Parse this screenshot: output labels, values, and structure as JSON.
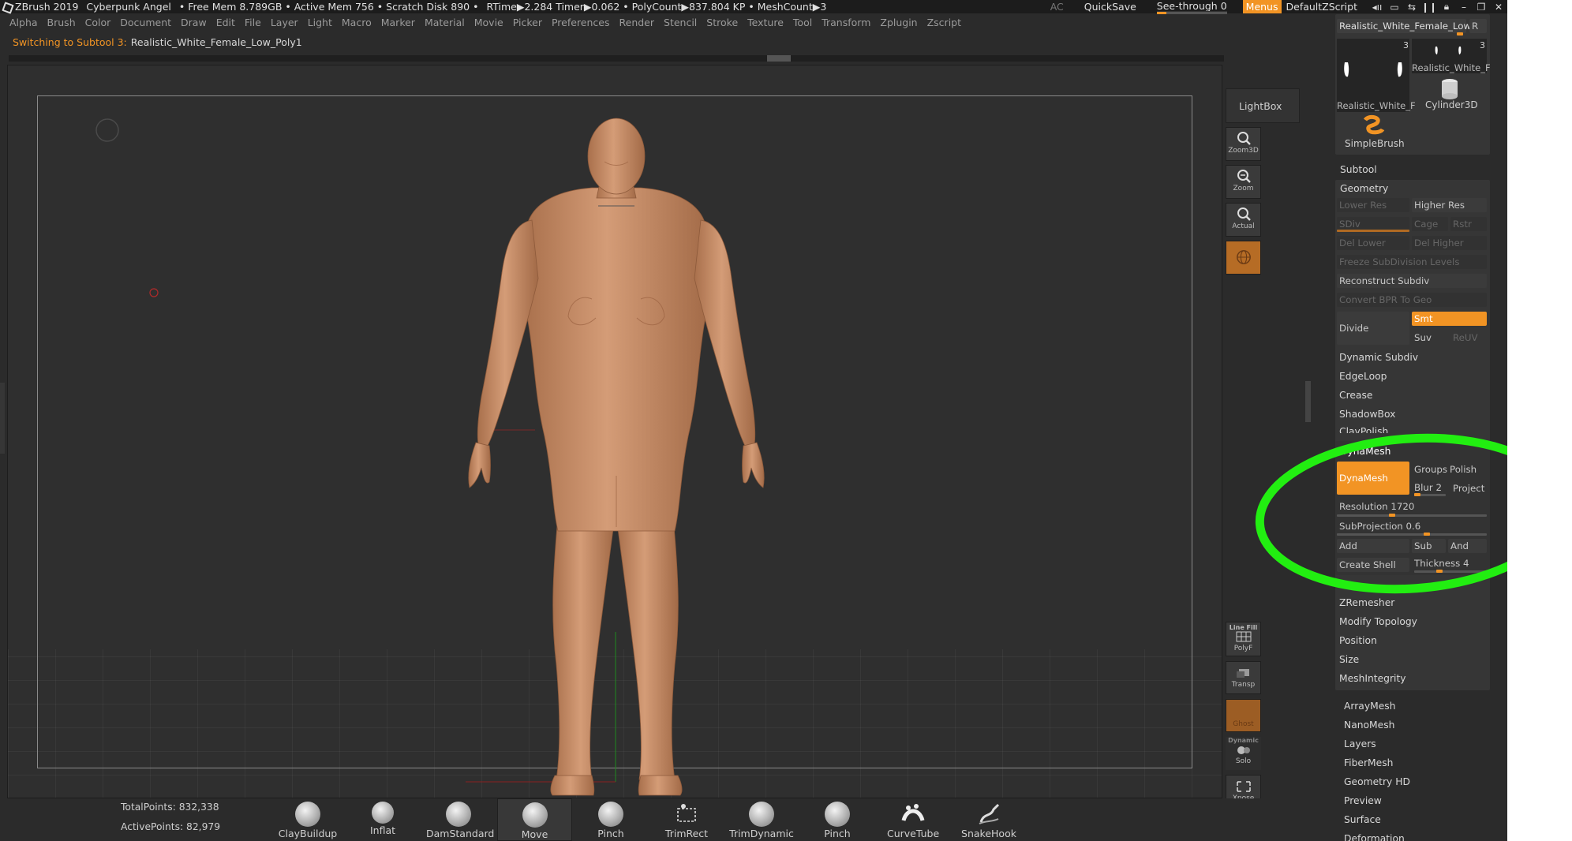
{
  "titlebar": {
    "app": "ZBrush 2019",
    "project": "Cyberpunk Angel",
    "stats": "• Free Mem 8.789GB • Active Mem 756 • Scratch Disk 890 •",
    "rtime": "RTime▶2.284 Timer▶0.062 • PolyCount▶837.804 KP • MeshCount▶3",
    "ac": "AC",
    "quicksave": "QuickSave",
    "seethrough": "See-through 0",
    "menus": "Menus",
    "script": "DefaultZScript"
  },
  "menubar": [
    "Alpha",
    "Brush",
    "Color",
    "Document",
    "Draw",
    "Edit",
    "File",
    "Layer",
    "Light",
    "Macro",
    "Marker",
    "Material",
    "Movie",
    "Picker",
    "Preferences",
    "Render",
    "Stencil",
    "Stroke",
    "Texture",
    "Tool",
    "Transform",
    "Zplugin",
    "Zscript"
  ],
  "notice": {
    "label": "Switching to Subtool 3:",
    "value": "Realistic_White_Female_Low_Poly1"
  },
  "shelf": {
    "lightbox": "LightBox",
    "zoom3d": "Zoom3D",
    "zoom": "Zoom",
    "actual": "Actual",
    "linefill_top": "Line Fill",
    "polyf": "PolyF",
    "transp": "Transp",
    "ghost": "Ghost",
    "dynamic": "Dynamic",
    "solo": "Solo",
    "xpose": "Xpose"
  },
  "tool_panel": {
    "current_tool": "Realistic_White_Female_Low",
    "r_button": "R",
    "thumbs": [
      {
        "label": "Realistic_White_F",
        "count": "3"
      },
      {
        "label": "Realistic_White_F",
        "count": "3"
      },
      {
        "label": "Cylinder3D"
      },
      {
        "label": "SimpleBrush"
      }
    ],
    "subtool": "Subtool",
    "geometry": "Geometry",
    "lower_res": "Lower Res",
    "higher_res": "Higher Res",
    "sdiv": "SDiv",
    "cage": "Cage",
    "rstr": "Rstr",
    "del_lower": "Del Lower",
    "del_higher": "Del Higher",
    "freeze": "Freeze SubDivision Levels",
    "reconstruct": "Reconstruct Subdiv",
    "convert_bpr": "Convert BPR To Geo",
    "divide": "Divide",
    "smt": "Smt",
    "suv": "Suv",
    "reuv": "ReUV",
    "dynamic_subdiv": "Dynamic Subdiv",
    "edgeloop": "EdgeLoop",
    "crease": "Crease",
    "shadowbox": "ShadowBox",
    "claypolish": "ClayPolish",
    "dynamesh_header": "DynaMesh",
    "dynamesh_btn": "DynaMesh",
    "groups": "Groups",
    "polish": "Polish",
    "blur": "Blur 2",
    "project": "Project",
    "resolution": "Resolution 1720",
    "subprojection": "SubProjection 0.6",
    "add": "Add",
    "sub": "Sub",
    "and": "And",
    "create_shell": "Create Shell",
    "thickness": "Thickness 4",
    "zremesher": "ZRemesher",
    "modify_topology": "Modify Topology",
    "position": "Position",
    "size": "Size",
    "mesh_integrity": "MeshIntegrity",
    "sections": [
      "ArrayMesh",
      "NanoMesh",
      "Layers",
      "FiberMesh",
      "Geometry HD",
      "Preview",
      "Surface",
      "Deformation"
    ]
  },
  "status": {
    "total_points": "TotalPoints: 832,338",
    "active_points": "ActivePoints: 82,979"
  },
  "brushes": [
    "ClayBuildup",
    "Inflat",
    "DamStandard",
    "Move",
    "Pinch",
    "TrimRect",
    "TrimDynamic",
    "Pinch",
    "CurveTube",
    "SnakeHook"
  ],
  "colors": {
    "accent": "#f29424",
    "annotation": "#22ee11",
    "skin": "#c98f6a"
  }
}
